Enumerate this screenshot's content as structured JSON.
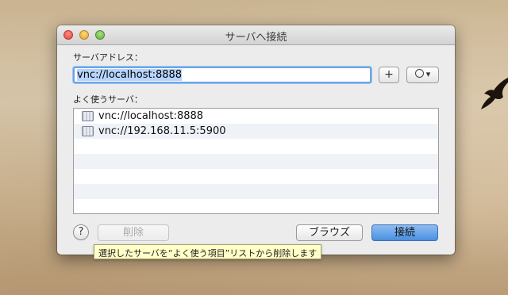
{
  "window": {
    "title": "サーバへ接続"
  },
  "form": {
    "address_label": "サーバアドレス：",
    "address_value": "vnc://localhost:8888",
    "add_button": "+",
    "options_arrow": "▾",
    "favorites_label": "よく使うサーバ："
  },
  "favorites": [
    {
      "address": "vnc://localhost:8888"
    },
    {
      "address": "vnc://192.168.11.5:5900"
    }
  ],
  "buttons": {
    "help": "?",
    "delete": "削除",
    "browse": "ブラウズ",
    "connect": "接続"
  },
  "tooltip": "選択したサーバを“よく使う項目”リストから削除します",
  "colors": {
    "accent": "#4b8fe0",
    "tooltip_bg": "#ffffc8"
  }
}
